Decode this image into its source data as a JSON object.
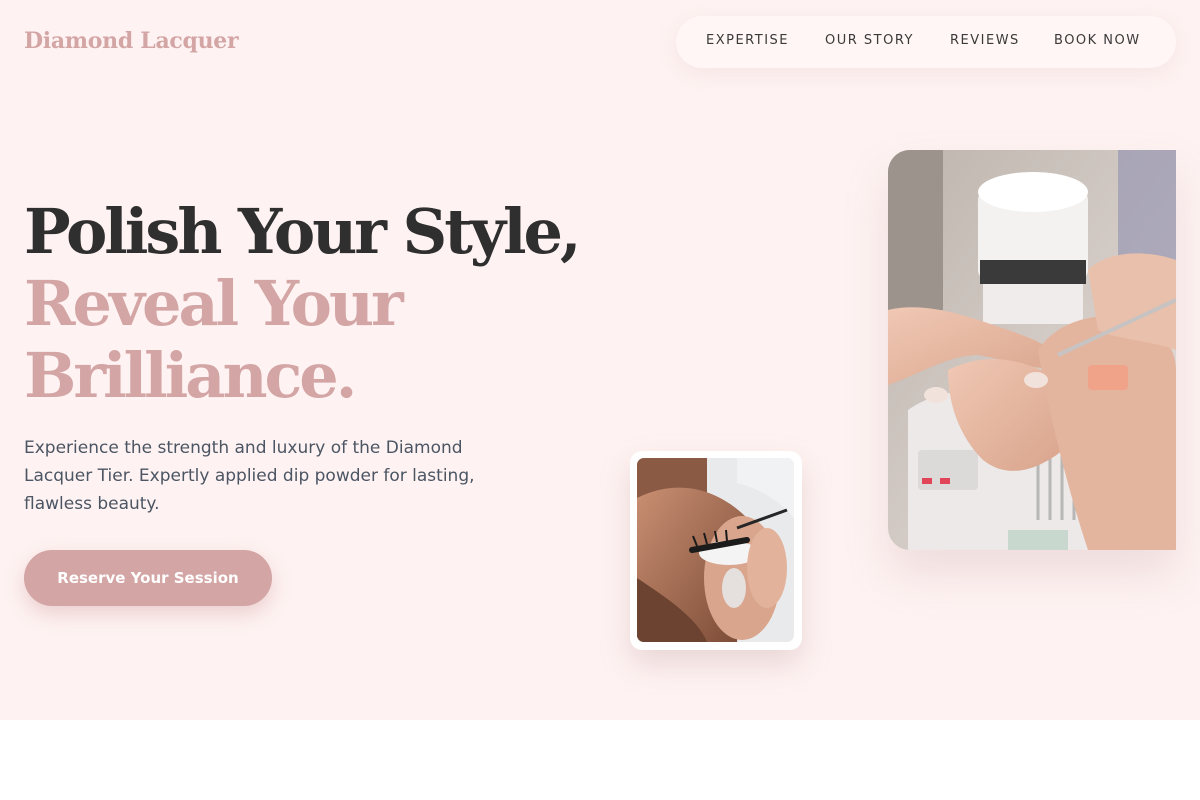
{
  "brand": {
    "name": "Diamond Lacquer"
  },
  "nav": {
    "items": [
      {
        "label": "EXPERTISE"
      },
      {
        "label": "OUR STORY"
      },
      {
        "label": "REVIEWS"
      },
      {
        "label": "BOOK NOW"
      }
    ]
  },
  "hero": {
    "headline_line1": "Polish Your Style,",
    "headline_line2": "Reveal Your",
    "headline_line3": "Brilliance.",
    "description": "Experience the strength and luxury of the Diamond Lacquer Tier. Expertly applied dip powder for lasting, flawless beauty.",
    "cta_label": "Reserve Your Session"
  },
  "colors": {
    "accent": "#d4a5a5",
    "hero_background": "#fef3f2",
    "headline_dark": "#2f2f2f",
    "body_text": "#4b5563"
  }
}
